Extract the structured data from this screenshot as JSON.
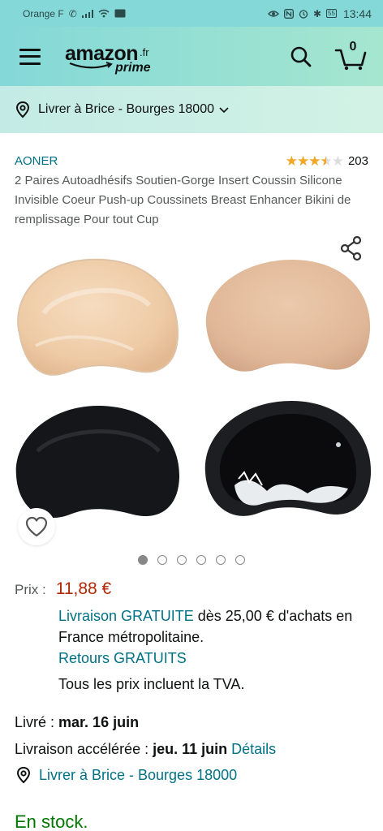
{
  "status_bar": {
    "carrier": "Orange F",
    "battery": "55",
    "time": "13:44"
  },
  "header": {
    "logo_word": "amazon",
    "logo_tld": ".fr",
    "logo_sub": "prime",
    "cart_count": "0"
  },
  "delivery_bar": {
    "text": "Livrer à Brice - Bourges 18000"
  },
  "product": {
    "brand": "AONER",
    "rating_stars": 3.5,
    "rating_count": "203",
    "title": "2 Paires Autoadhésifs Soutien-Gorge Insert Coussin Silicone Invisible Coeur Push-up Coussinets Breast Enhancer Bikini de remplissage Pour tout Cup"
  },
  "gallery": {
    "image_count": 6,
    "active_index": 0
  },
  "price": {
    "label": "Prix :",
    "value": "11,88 €",
    "free_delivery_link": "Livraison GRATUITE",
    "free_delivery_text": " dès 25,00 € d'achats en France métropolitaine.",
    "returns_link": "Retours GRATUITS",
    "vat_text": "Tous les prix incluent la TVA."
  },
  "delivery": {
    "delivered_label": "Livré : ",
    "delivered_date": "mar. 16 juin",
    "express_label": "Livraison accélérée : ",
    "express_date": "jeu. 11 juin",
    "details_link": "Détails",
    "location_text": "Livrer à Brice - Bourges 18000"
  },
  "stock": {
    "text": "En stock."
  },
  "colors": {
    "header_teal": "#84d8d8",
    "link": "#007185",
    "price": "#b12704",
    "in_stock": "#007600",
    "star": "#f5a623"
  }
}
